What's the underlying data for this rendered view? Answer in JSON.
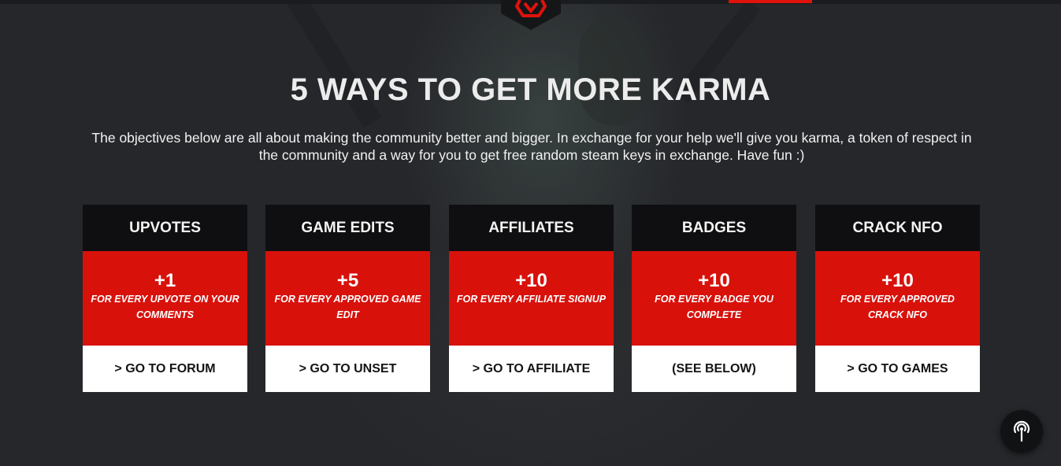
{
  "colors": {
    "accent": "#d8110b",
    "background": "#26272b",
    "card_head": "#0f0f11",
    "card_foot": "#ffffff"
  },
  "header": {
    "logo_icon": "hex-logo-icon"
  },
  "main": {
    "title": "5 WAYS TO GET MORE KARMA",
    "intro": "The objectives below are all about making the community better and bigger. In exchange for your help we'll give you karma, a token of respect in the community and a way for you to get free random steam keys in exchange. Have fun :)",
    "cards": [
      {
        "title": "UPVOTES",
        "points": "+1",
        "description": "FOR EVERY UPVOTE ON YOUR COMMENTS",
        "link": "> GO TO FORUM"
      },
      {
        "title": "GAME EDITS",
        "points": "+5",
        "description": "FOR EVERY APPROVED GAME EDIT",
        "link": "> GO TO UNSET"
      },
      {
        "title": "AFFILIATES",
        "points": "+10",
        "description": "FOR EVERY AFFILIATE SIGNUP",
        "link": "> GO TO AFFILIATE"
      },
      {
        "title": "BADGES",
        "points": "+10",
        "description": "FOR EVERY BADGE YOU COMPLETE",
        "link": "(SEE BELOW)"
      },
      {
        "title": "CRACK NFO",
        "points": "+10",
        "description": "FOR EVERY APPROVED CRACK NFO",
        "link": "> GO TO GAMES"
      }
    ]
  },
  "fab": {
    "icon": "broadcast-icon"
  }
}
